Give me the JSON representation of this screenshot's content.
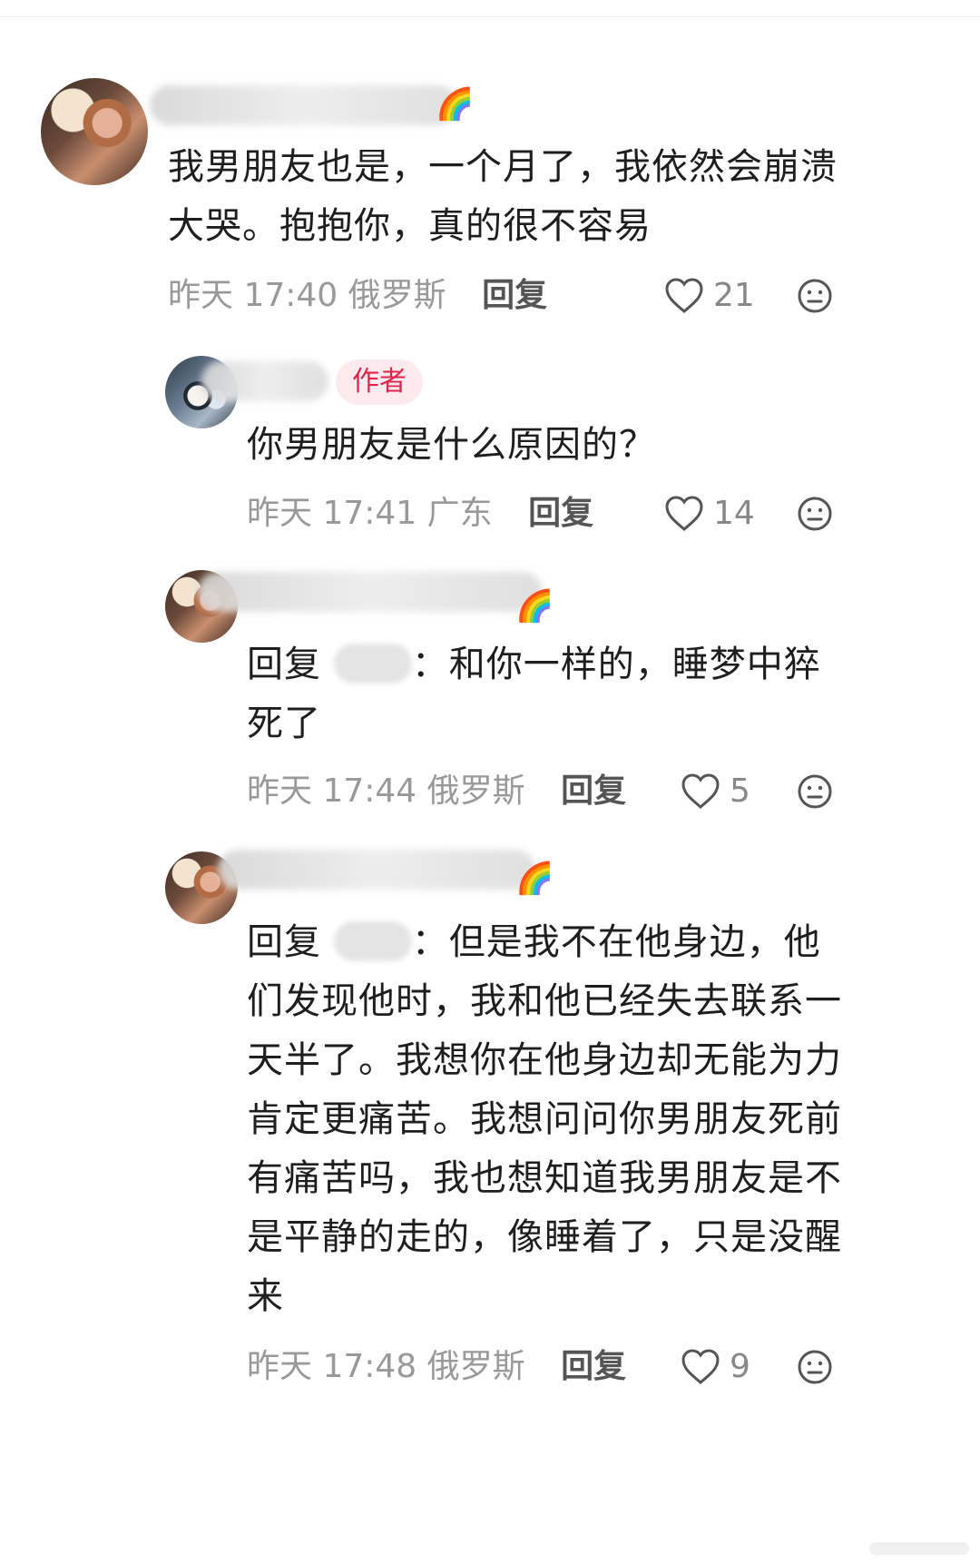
{
  "comments": [
    {
      "text": "我男朋友也是，一个月了，我依然会崩溃大哭。抱抱你，真的很不容易",
      "time": "昨天 17:40",
      "location": "俄罗斯",
      "reply_label": "回复",
      "likes": "21",
      "avatar_icon": "user-avatar-photo",
      "badge_icon": "rainbow-emoji"
    },
    {
      "author_tag": "作者",
      "text": "你男朋友是什么原因的？",
      "time": "昨天 17:41",
      "location": "广东",
      "reply_label": "回复",
      "likes": "14",
      "avatar_icon": "author-avatar-anime"
    },
    {
      "reply_prefix": "回复",
      "reply_suffix": "：和你一样的，睡梦中猝死了",
      "time": "昨天 17:44",
      "location": "俄罗斯",
      "reply_label": "回复",
      "likes": "5",
      "avatar_icon": "user-avatar-photo",
      "badge_icon": "rainbow-emoji"
    },
    {
      "reply_prefix": "回复",
      "reply_suffix": "：但是我不在他身边，他们发现他时，我和他已经失去联系一天半了。我想你在他身边却无能为力肯定更痛苦。我想问问你男朋友死前有痛苦吗，我也想知道我男朋友是不是平静的走的，像睡着了，只是没醒来",
      "time": "昨天 17:48",
      "location": "俄罗斯",
      "reply_label": "回复",
      "likes": "9",
      "avatar_icon": "user-avatar-photo",
      "badge_icon": "rainbow-emoji"
    }
  ],
  "colors": {
    "author_tag_text": "#e0244a",
    "author_tag_bg": "#fdeaee",
    "meta_text": "#999999",
    "reply_text": "#555555"
  }
}
